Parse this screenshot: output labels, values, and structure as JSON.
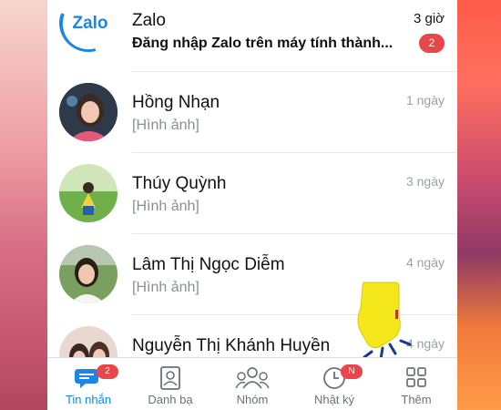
{
  "chats": [
    {
      "name": "Zalo",
      "preview": "Đăng nhập Zalo trên máy tính thành...",
      "time": "3 giờ",
      "unread": "2"
    },
    {
      "name": "Hồng Nhạn",
      "preview": "[Hình ảnh]",
      "time": "1 ngày"
    },
    {
      "name": "Thúy Quỳnh",
      "preview": "[Hình ảnh]",
      "time": "3 ngày"
    },
    {
      "name": "Lâm Thị Ngọc Diễm",
      "preview": "[Hình ảnh]",
      "time": "4 ngày"
    },
    {
      "name": "Nguyễn Thị Khánh Huyền",
      "preview": "",
      "time": "4 ngày"
    }
  ],
  "zalo_logo_text": "Zalo",
  "tabs": [
    {
      "label": "Tin nhắn",
      "badge": "2",
      "icon": "chat-icon"
    },
    {
      "label": "Danh bạ",
      "icon": "contacts-icon"
    },
    {
      "label": "Nhóm",
      "icon": "groups-icon"
    },
    {
      "label": "Nhật ký",
      "badge": "N",
      "icon": "clock-icon"
    },
    {
      "label": "Thêm",
      "icon": "grid-icon"
    }
  ],
  "colors": {
    "accent": "#1a86e8",
    "badge": "#e8464a",
    "hand": "#f4e81a"
  }
}
